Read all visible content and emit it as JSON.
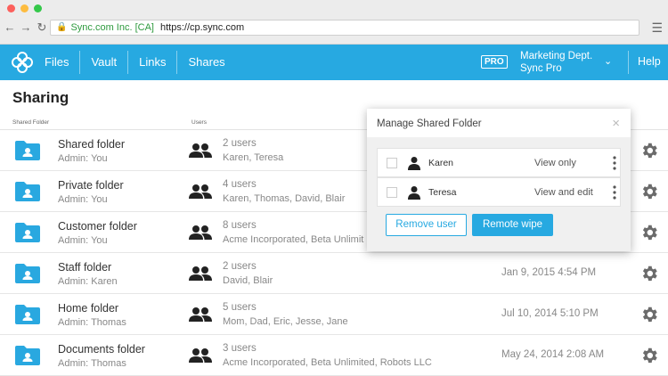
{
  "browser": {
    "cert_label": "Sync.com Inc. [CA]",
    "url": "https://cp.sync.com",
    "back_icon": "arrow-left-icon",
    "forward_icon": "arrow-right-icon",
    "reload_icon": "reload-icon",
    "lock_icon": "lock-icon",
    "menu_icon": "hamburger-menu-icon"
  },
  "nav": {
    "items": [
      "Files",
      "Vault",
      "Links",
      "Shares"
    ],
    "pro_badge": "PRO",
    "account_line1": "Marketing Dept.",
    "account_line2": "Sync Pro",
    "help": "Help"
  },
  "page": {
    "title": "Sharing",
    "col_shared_folder": "Shared Folder",
    "col_users": "Users"
  },
  "folders": [
    {
      "name": "Shared folder",
      "admin": "Admin: You",
      "user_count": "2 users",
      "users": "Karen, Teresa",
      "date": ""
    },
    {
      "name": "Private folder",
      "admin": "Admin: You",
      "user_count": "4 users",
      "users": "Karen, Thomas, David, Blair",
      "date": ""
    },
    {
      "name": "Customer folder",
      "admin": "Admin: You",
      "user_count": "8 users",
      "users": "Acme Incorporated, Beta Unlimit",
      "date": ""
    },
    {
      "name": "Staff folder",
      "admin": "Admin: Karen",
      "user_count": "2 users",
      "users": "David, Blair",
      "date": "Jan 9, 2015   4:54 PM"
    },
    {
      "name": "Home folder",
      "admin": "Admin: Thomas",
      "user_count": "5 users",
      "users": "Mom, Dad, Eric, Jesse, Jane",
      "date": "Jul 10, 2014   5:10 PM"
    },
    {
      "name": "Documents folder",
      "admin": "Admin: Thomas",
      "user_count": "3 users",
      "users": "Acme Incorporated, Beta Unlimited, Robots LLC",
      "date": "May 24, 2014   2:08 AM"
    }
  ],
  "modal": {
    "title": "Manage Shared Folder",
    "close": "×",
    "users": [
      {
        "name": "Karen",
        "permission": "View only"
      },
      {
        "name": "Teresa",
        "permission": "View and edit"
      }
    ],
    "remove_button": "Remove user",
    "wipe_button": "Remote wipe"
  },
  "colors": {
    "brand_blue": "#27a9e1",
    "folder_blue": "#29a8e0"
  }
}
